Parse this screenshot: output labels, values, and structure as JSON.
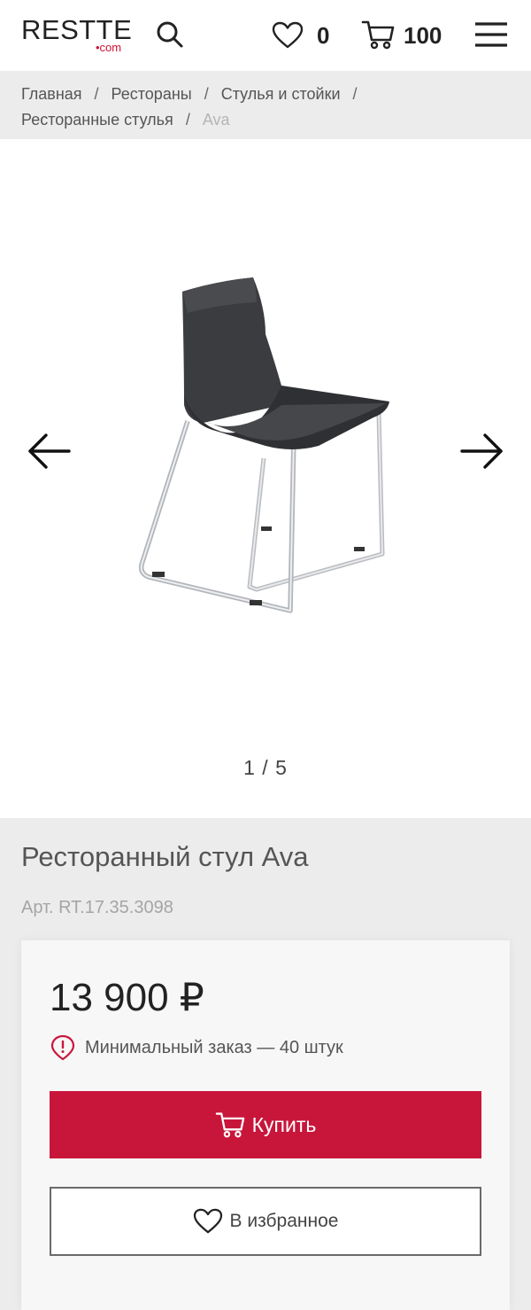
{
  "header": {
    "logo_text": "RESTTE",
    "logo_suffix": "•com",
    "favorites_count": "0",
    "cart_count": "100",
    "icons": [
      "search-icon",
      "heart-icon",
      "cart-icon",
      "menu-icon"
    ]
  },
  "breadcrumb": {
    "items": [
      "Главная",
      "Рестораны",
      "Стулья и стойки",
      "Ресторанные стулья"
    ],
    "current": "Ava",
    "separator": "/"
  },
  "gallery": {
    "counter": "1 / 5",
    "current_index": 1,
    "total": 5
  },
  "product": {
    "title": "Ресторанный стул Ava",
    "sku_label": "Арт.",
    "sku_value": "RT.17.35.3098",
    "price": "13 900 ₽",
    "min_order": "Минимальный заказ — 40 штук",
    "buy_label": "Купить",
    "favorite_label": "В избранное"
  },
  "colors": {
    "accent": "#c8163b",
    "breadcrumb_bg": "#ececec",
    "text_dark": "#222222"
  }
}
